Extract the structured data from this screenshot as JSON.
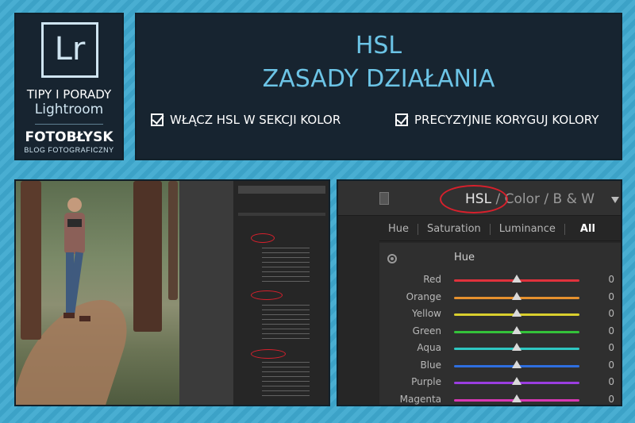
{
  "logo": {
    "app_mark": "Lr",
    "tips": "TIPY I PORADY",
    "app_name": "Lightroom",
    "brand": "FOTOBŁYSK",
    "brand_sub": "BLOG FOTOGRAFICZNY"
  },
  "title": {
    "line1": "HSL",
    "line2": "ZASADY DZIAŁANIA",
    "tips": [
      "WŁĄCZ HSL W SEKCJI KOLOR",
      "PRECYZYJNIE KORYGUJ KOLORY"
    ]
  },
  "hsl_panel": {
    "mode_hsl": "HSL",
    "mode_sep1": "/",
    "mode_color": "Color",
    "mode_sep2": "/",
    "mode_bw": "B & W",
    "tabs": [
      "Hue",
      "Saturation",
      "Luminance",
      "All"
    ],
    "active_tab": "All",
    "section_title": "Hue",
    "sliders": [
      {
        "label": "Red",
        "value": "0",
        "color": "#e0323c"
      },
      {
        "label": "Orange",
        "value": "0",
        "color": "#e6912e"
      },
      {
        "label": "Yellow",
        "value": "0",
        "color": "#d9cf2e"
      },
      {
        "label": "Green",
        "value": "0",
        "color": "#34c23a"
      },
      {
        "label": "Aqua",
        "value": "0",
        "color": "#2ec7c2"
      },
      {
        "label": "Blue",
        "value": "0",
        "color": "#2e6fe0"
      },
      {
        "label": "Purple",
        "value": "0",
        "color": "#9a3ee0"
      },
      {
        "label": "Magenta",
        "value": "0",
        "color": "#d837b4"
      }
    ],
    "highlight_color": "#d8202c"
  },
  "colors": {
    "background": "#3ea9cf",
    "panel": "#172430",
    "title_accent": "#6cc4e6"
  },
  "icons": [
    "check-icon",
    "target-adjust-icon",
    "collapse-arrow-icon",
    "panel-switch-icon"
  ]
}
